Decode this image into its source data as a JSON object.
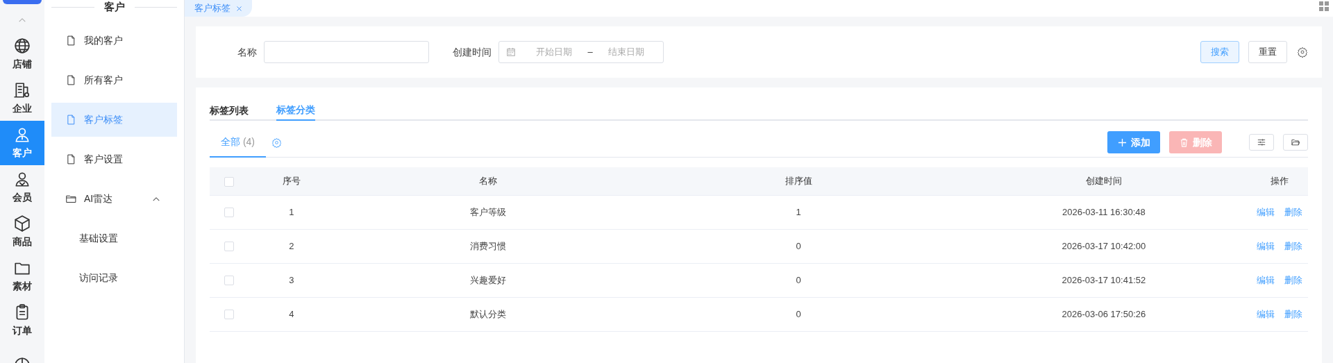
{
  "rail": {
    "items": [
      {
        "label": "店铺",
        "kind": "globe",
        "selected": false
      },
      {
        "label": "企业",
        "kind": "building",
        "selected": false
      },
      {
        "label": "客户",
        "kind": "person",
        "selected": true
      },
      {
        "label": "会员",
        "kind": "member",
        "selected": false
      },
      {
        "label": "商品",
        "kind": "box",
        "selected": false
      },
      {
        "label": "素材",
        "kind": "folder",
        "selected": false
      },
      {
        "label": "订单",
        "kind": "clipboard",
        "selected": false
      },
      {
        "kind": "pie",
        "selected": false
      }
    ]
  },
  "submenu": {
    "title": "客户",
    "items": [
      {
        "label": "我的客户",
        "kind": "page",
        "selected": false
      },
      {
        "label": "所有客户",
        "kind": "page",
        "selected": false
      },
      {
        "label": "客户标签",
        "kind": "page",
        "selected": true
      },
      {
        "label": "客户设置",
        "kind": "page",
        "selected": false
      },
      {
        "label": "AI雷达",
        "kind": "folder",
        "selected": false,
        "expanded": true,
        "children": [
          {
            "label": "基础设置",
            "selected": false
          },
          {
            "label": "访问记录",
            "selected": false
          }
        ]
      }
    ]
  },
  "page_tabs": [
    {
      "label": "客户标签",
      "selected": true
    }
  ],
  "filter": {
    "name_label": "名称",
    "date_label": "创建时间",
    "start_placeholder": "开始日期",
    "separator": "–",
    "end_placeholder": "结束日期",
    "search_button": "搜索",
    "reset_button": "重置"
  },
  "tabs": [
    {
      "label": "标签列表",
      "selected": false
    },
    {
      "label": "标签分类",
      "selected": true
    }
  ],
  "sub_tabs": [
    {
      "label": "全部",
      "count": "(4)",
      "selected": true
    }
  ],
  "toolbar": {
    "add_button": "添加",
    "delete_button": "删除",
    "delete_disabled": true
  },
  "table": {
    "columns": [
      "序号",
      "名称",
      "排序值",
      "创建时间",
      "操作"
    ],
    "header_checked": false,
    "rows": [
      {
        "checked": false,
        "index": "1",
        "name": "客户等级",
        "sort": "1",
        "created": "2026-03-11 16:30:48",
        "actions": [
          "编辑",
          "删除"
        ]
      },
      {
        "checked": false,
        "index": "2",
        "name": "消费习惯",
        "sort": "0",
        "created": "2026-03-17 10:42:00",
        "actions": [
          "编辑",
          "删除"
        ]
      },
      {
        "checked": false,
        "index": "3",
        "name": "兴趣爱好",
        "sort": "0",
        "created": "2026-03-17 10:41:52",
        "actions": [
          "编辑",
          "删除"
        ]
      },
      {
        "checked": false,
        "index": "4",
        "name": "默认分类",
        "sort": "0",
        "created": "2026-03-06 17:50:26",
        "actions": [
          "编辑",
          "删除"
        ]
      }
    ]
  }
}
